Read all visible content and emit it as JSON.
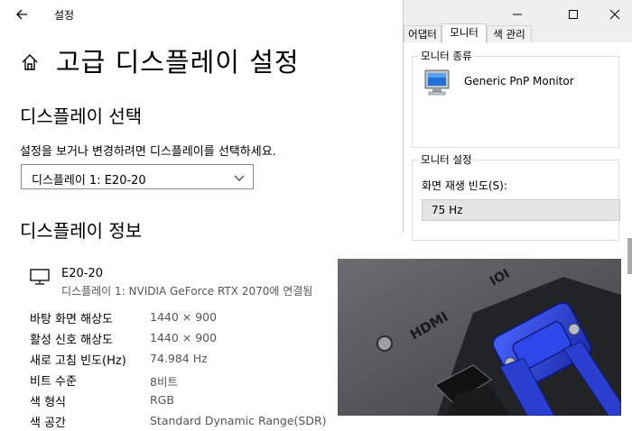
{
  "app": {
    "back_icon": "back-arrow-icon",
    "title": "설정"
  },
  "page": {
    "home_icon": "home-icon",
    "title": "고급 디스플레이 설정"
  },
  "display_select": {
    "heading": "디스플레이 선택",
    "prompt": "설정을 보거나 변경하려면 디스플레이를 선택하세요.",
    "selected": "디스플레이 1: E20-20"
  },
  "display_info": {
    "heading": "디스플레이 정보",
    "monitor_name": "E20-20",
    "monitor_sub": "디스플레이 1: NVIDIA GeForce RTX 2070에 연결됨",
    "rows": [
      {
        "label": "바탕 화면 해상도",
        "value": "1440 × 900"
      },
      {
        "label": "활성 신호 해상도",
        "value": "1440 × 900"
      },
      {
        "label": "새로 고침 빈도(Hz)",
        "value": "74.984 Hz"
      },
      {
        "label": "비트 수준",
        "value": "8비트"
      },
      {
        "label": "색 형식",
        "value": "RGB"
      },
      {
        "label": "색 공간",
        "value": "Standard Dynamic Range(SDR)"
      }
    ]
  },
  "dialog": {
    "tabs": [
      "어댑터",
      "모니터",
      "색 관리"
    ],
    "active_tab": "모니터",
    "monitor_type_title": "모니터 종류",
    "monitor_type": "Generic PnP Monitor",
    "monitor_settings_title": "모니터 설정",
    "refresh_label": "화면 재생 빈도(S):",
    "refresh_value": "75 Hz"
  },
  "photo": {
    "hdmi_text": "HDMI",
    "vga_text": "IOI"
  },
  "colors": {
    "dialog_bg": "#f0f0f0",
    "vga_blue": "#2a3fd0",
    "panel_gray": "#5a5c5e"
  }
}
